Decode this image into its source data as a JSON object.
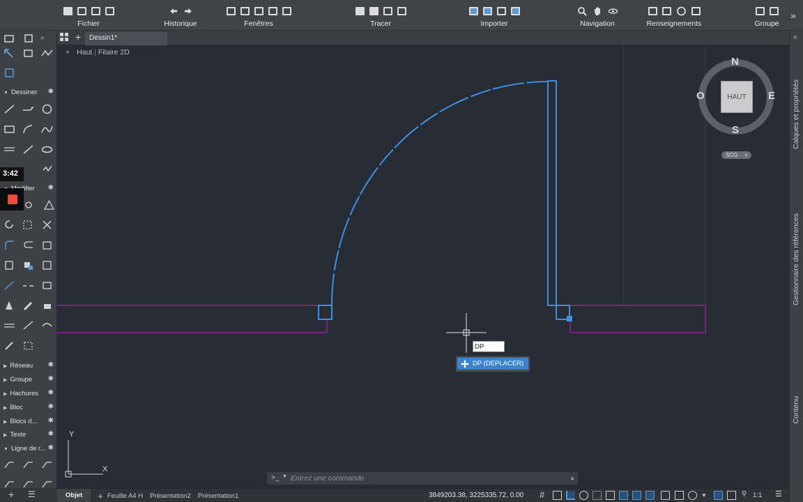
{
  "ribbon": {
    "groups": [
      {
        "label": "Fichier"
      },
      {
        "label": "Historique"
      },
      {
        "label": "Fenêtres"
      },
      {
        "label": "Tracer"
      },
      {
        "label": "Importer"
      },
      {
        "label": "Navigation"
      },
      {
        "label": "Renseignements"
      },
      {
        "label": "Groupe"
      }
    ]
  },
  "tabs": {
    "document": "Dessin1*"
  },
  "viewport": {
    "view": "Haut",
    "style": "Filaire 2D"
  },
  "palette": {
    "sections": [
      {
        "label": "Dessiner"
      },
      {
        "label": "Modifier"
      },
      {
        "label": "Réseau"
      },
      {
        "label": "Groupe"
      },
      {
        "label": "Hachures"
      },
      {
        "label": "Bloc"
      },
      {
        "label": "Blocs d..."
      },
      {
        "label": "Texte"
      },
      {
        "label": "Ligne de r..."
      }
    ]
  },
  "viewcube": {
    "north": "N",
    "south": "S",
    "east": "E",
    "west": "O",
    "face": "HAUT",
    "ucs": "SCG"
  },
  "ucs_icon": {
    "y_label": "Y",
    "x_label": "X"
  },
  "right_panel": {
    "tabs": [
      "Calques et propriétés",
      "Gestionnaire des références",
      "Contenu"
    ]
  },
  "command": {
    "prompt": ">_",
    "placeholder": "Entrez une commande",
    "dynamic_input": "DP",
    "suggestion": "DP (DEPLACER)"
  },
  "status": {
    "layout_tabs": [
      "Objet",
      "Feuille A4 H",
      "Présentation2",
      "Présentation1"
    ],
    "coordinates": "3849203.38, 3225335.72, 0.00",
    "scale": "1:1"
  },
  "overlay": {
    "timer": "3:42"
  },
  "colors": {
    "accent": "#4f9fe6",
    "selection": "#3b8de0",
    "wall": "#b020a8",
    "canvas": "#282c34"
  }
}
